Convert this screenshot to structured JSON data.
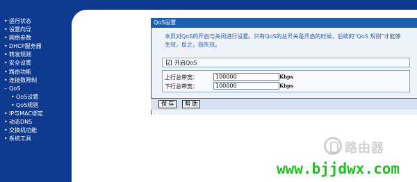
{
  "sidebar": {
    "items": [
      {
        "label": "运行状态",
        "sub": false
      },
      {
        "label": "设置向导",
        "sub": false
      },
      {
        "label": "网络参数",
        "sub": false
      },
      {
        "label": "DHCP服务器",
        "sub": false
      },
      {
        "label": "转发规则",
        "sub": false
      },
      {
        "label": "安全设置",
        "sub": false
      },
      {
        "label": "路由功能",
        "sub": false
      },
      {
        "label": "连接数限制",
        "sub": false
      },
      {
        "label": "QoS",
        "sub": false
      },
      {
        "label": "QoS设置",
        "sub": true
      },
      {
        "label": "QoS规则",
        "sub": true
      },
      {
        "label": "IP与MAC绑定",
        "sub": false
      },
      {
        "label": "动态DNS",
        "sub": false
      },
      {
        "label": "交换机功能",
        "sub": false
      },
      {
        "label": "系统工具",
        "sub": false
      }
    ]
  },
  "panel": {
    "title": "QoS设置",
    "intro": "本页对QoS的开启与关闭进行设置。只有QoS的总开关是开启的时候，后续的“QoS 规则”才能够生效，反之，则失效。",
    "enable_label": "开启QoS",
    "enable_checked": true,
    "up_label": "上行总带宽：",
    "up_value": "100000",
    "up_unit": "Kbps",
    "down_label": "下行总带宽：",
    "down_value": "100000",
    "down_unit": "Kbps",
    "save_label": "保 存",
    "help_label": "帮 助"
  },
  "watermark": {
    "brand": "路由器",
    "url": "www.bjjdwx.com"
  },
  "colors": {
    "sidebar": "#0d3a8f",
    "panel_header": "#1c5fb2",
    "watermark_url": "#1fc11f"
  }
}
